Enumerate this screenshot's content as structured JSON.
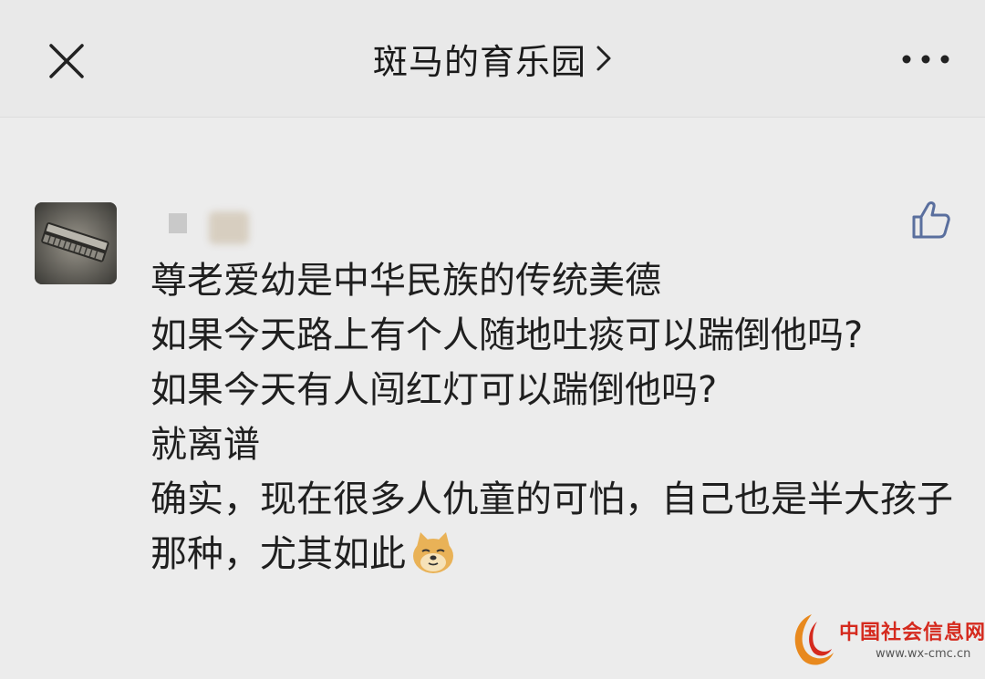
{
  "header": {
    "title": "斑马的育乐园",
    "title_chevron_icon": "chevron-right-icon",
    "close_icon": "close-icon",
    "more_icon": "more-dots-icon"
  },
  "comment": {
    "avatar_icon": "harmonica-avatar",
    "like_icon": "thumbs-up-icon",
    "lines": [
      "尊老爱幼是中华民族的传统美德",
      "如果今天路上有个人随地吐痰可以踹倒他吗?",
      "如果今天有人闯红灯可以踹倒他吗?",
      "就离谱",
      "确实，现在很多人仇童的可怕，自己也是半大孩子那种，尤其如此"
    ],
    "emoji": "doge-emoji"
  },
  "watermark": {
    "name": "中国社会信息网",
    "url": "www.wx-cmc.cn"
  },
  "colors": {
    "background": "#ececec",
    "header_bg": "#e9e9e9",
    "text": "#1f1f1f",
    "icon_blue": "#5a6f9e",
    "watermark_red": "#d52a1e"
  }
}
